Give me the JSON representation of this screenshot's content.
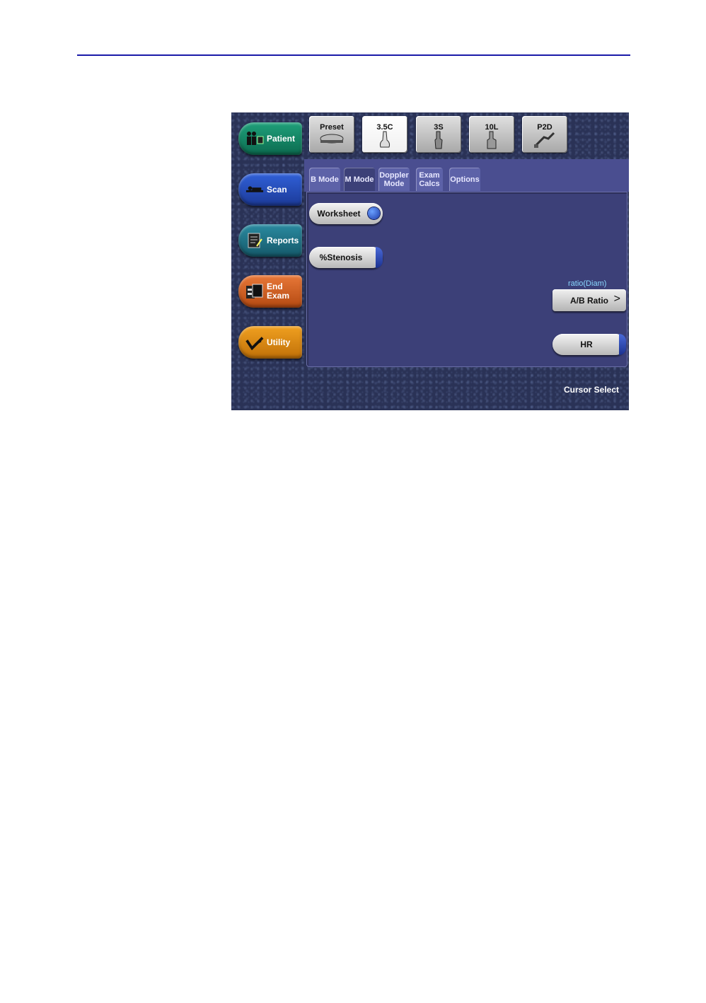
{
  "side_menu": [
    {
      "label": "Patient",
      "icon": "patient-icon"
    },
    {
      "label": "Scan",
      "icon": "scan-icon"
    },
    {
      "label": "Reports",
      "icon": "reports-icon"
    },
    {
      "label": "End Exam",
      "line1": "End",
      "line2": "Exam",
      "icon": "end-exam-icon"
    },
    {
      "label": "Utility",
      "icon": "utility-icon"
    }
  ],
  "probes": [
    {
      "label": "Preset",
      "selected": false
    },
    {
      "label": "3.5C",
      "selected": true
    },
    {
      "label": "3S",
      "selected": false
    },
    {
      "label": "10L",
      "selected": false
    },
    {
      "label": "P2D",
      "selected": false
    }
  ],
  "tabs": [
    {
      "label": "B Mode"
    },
    {
      "label": "M Mode",
      "active": true
    },
    {
      "line1": "Doppler",
      "line2": "Mode"
    },
    {
      "line1": "Exam",
      "line2": "Calcs"
    },
    {
      "label": "Options"
    }
  ],
  "panel": {
    "worksheet_label": "Worksheet",
    "stenosis_label": "%Stenosis",
    "ratio_caption": "ratio(Diam)",
    "ab_ratio_label": "A/B Ratio",
    "ab_ratio_arrow": ">",
    "hr_label": "HR"
  },
  "status": {
    "cursor_select": "Cursor Select"
  },
  "colors": {
    "rule": "#1a1aa8",
    "panel": "#3c4078",
    "caption": "#8ad8ff"
  }
}
